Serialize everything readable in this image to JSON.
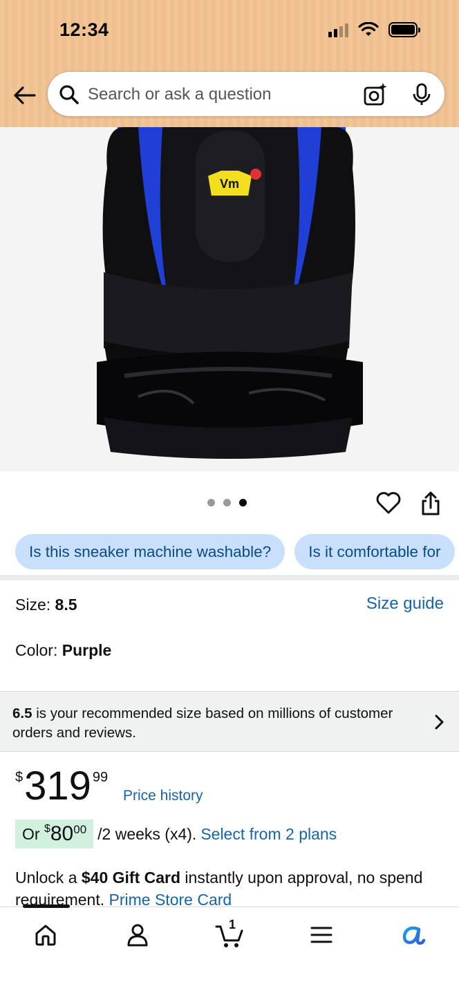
{
  "status_bar": {
    "time": "12:34"
  },
  "search": {
    "placeholder": "Search or ask a question"
  },
  "gallery": {
    "dot_count": 3,
    "active_dot": 3
  },
  "chips": [
    "Is this sneaker machine washable?",
    "Is it comfortable for"
  ],
  "size": {
    "label": "Size: ",
    "value": "8.5",
    "guide_label": "Size guide"
  },
  "color": {
    "label": "Color: ",
    "value": "Purple"
  },
  "recommendation": {
    "size": "6.5",
    "text": " is your recommended size based on millions of customer orders and reviews."
  },
  "price": {
    "symbol": "$",
    "whole": "319",
    "fraction": "99",
    "history_label": "Price history"
  },
  "installment": {
    "prefix": "Or ",
    "symbol": "$",
    "whole": "80",
    "fraction": "00",
    "period": "/2 weeks (x4).",
    "link": "Select from 2 plans"
  },
  "promo": {
    "text1": "Unlock a ",
    "bold": "$40 Gift Card",
    "text2": " instantly upon approval, no spend requirement. ",
    "link": "Prime Store Card"
  },
  "cart": {
    "count": "1"
  },
  "icons": {
    "back": "back-arrow-icon",
    "search": "search-icon",
    "camera": "camera-sparkle-icon",
    "mic": "mic-icon",
    "heart": "heart-icon",
    "share": "share-icon",
    "home": "home-icon",
    "account": "account-icon",
    "cart": "cart-icon",
    "menu": "menu-icon",
    "rufus": "rufus-icon"
  },
  "colors": {
    "header": "#f2c596",
    "link": "#1565a8",
    "chip_bg": "#c8e0fb",
    "installment_bg": "#d1f1de"
  }
}
